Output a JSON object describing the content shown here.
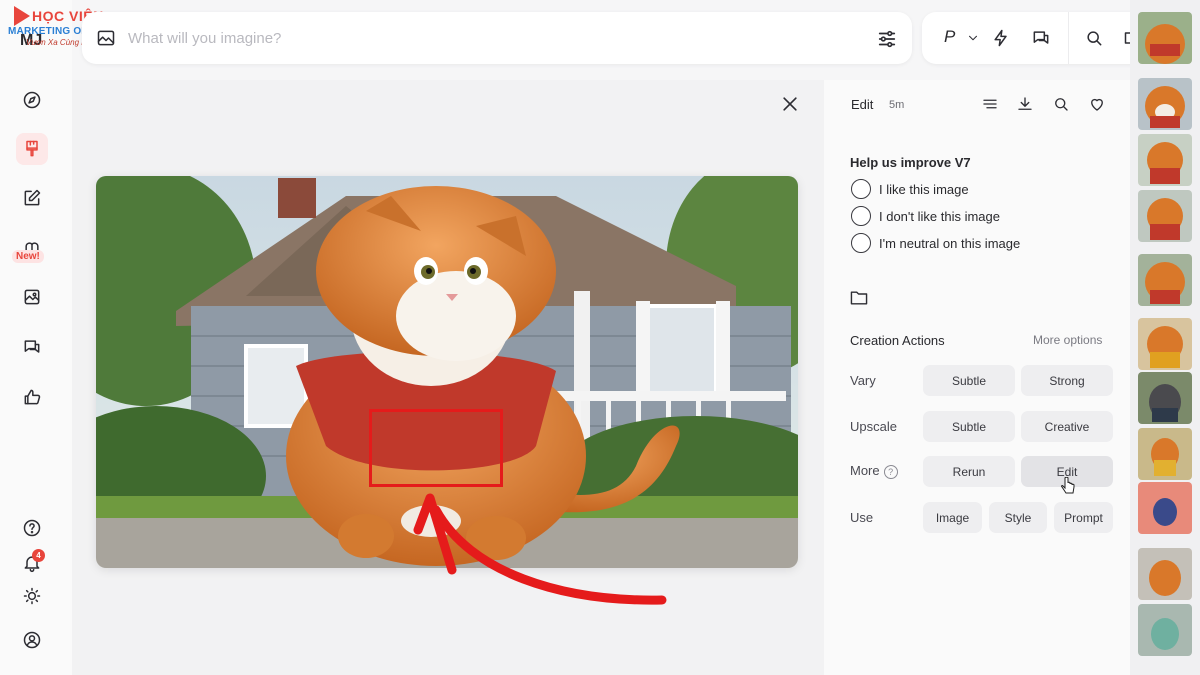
{
  "logo": {
    "line1": "HỌC VIỆN",
    "line2": "MARKETING ONLINE",
    "line3": "Vươn Xa Cùng Bạn"
  },
  "app": {
    "brand": "MJ"
  },
  "search": {
    "placeholder": "What will you imagine?",
    "value": ""
  },
  "toolbar": {
    "profile_label": "P"
  },
  "sidebar": {
    "items": [
      {
        "name": "explore",
        "icon": "compass-icon"
      },
      {
        "name": "create",
        "icon": "brush-icon",
        "active": true
      },
      {
        "name": "edit",
        "icon": "edit-icon"
      },
      {
        "name": "personalize",
        "icon": "personalize-icon",
        "badge": "New!"
      },
      {
        "name": "organize",
        "icon": "image-icon"
      },
      {
        "name": "chat",
        "icon": "chat-icon"
      },
      {
        "name": "rank",
        "icon": "thumbs-up-icon"
      }
    ],
    "bottom": {
      "notifications_count": "4"
    }
  },
  "panel": {
    "mode_label": "Edit",
    "age": "5m",
    "feedback": {
      "title": "Help us improve V7",
      "options": [
        "I like this image",
        "I don't like this image",
        "I'm neutral on this image"
      ]
    },
    "creation_actions": {
      "title": "Creation Actions",
      "more_options": "More options",
      "rows": [
        {
          "label": "Vary",
          "buttons": [
            "Subtle",
            "Strong"
          ]
        },
        {
          "label": "Upscale",
          "buttons": [
            "Subtle",
            "Creative"
          ]
        },
        {
          "label": "More",
          "buttons": [
            "Rerun",
            "Edit"
          ]
        },
        {
          "label": "Use",
          "buttons": [
            "Image",
            "Style",
            "Prompt"
          ]
        }
      ]
    }
  },
  "colors": {
    "accent": "#e8453c",
    "annotation": "#e51b1b",
    "cat_orange": "#d9782a",
    "shirt_red": "#c0392b"
  }
}
